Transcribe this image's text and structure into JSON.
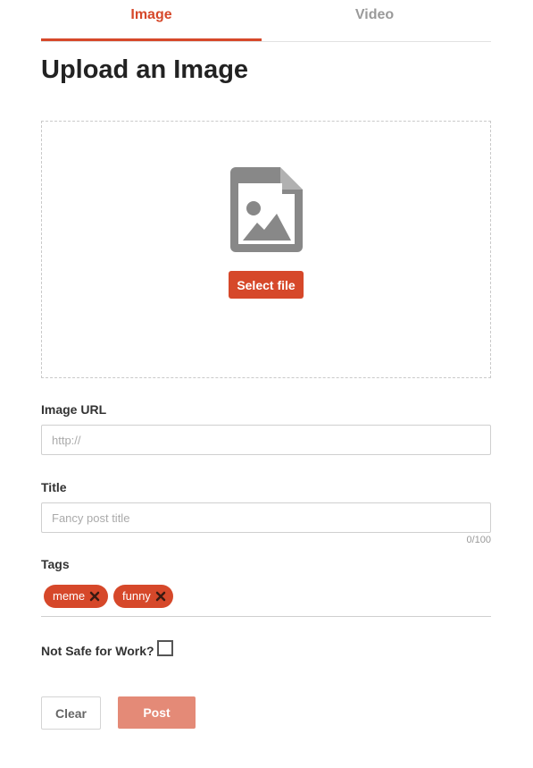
{
  "tabs": [
    {
      "label": "Image",
      "active": true
    },
    {
      "label": "Video",
      "active": false
    }
  ],
  "page_title": "Upload an Image",
  "dropzone": {
    "icon": "image-file-icon",
    "select_label": "Select file"
  },
  "image_url": {
    "label": "Image URL",
    "value": "",
    "placeholder": "http://"
  },
  "title_field": {
    "label": "Title",
    "value": "",
    "placeholder": "Fancy post title",
    "counter": "0/100"
  },
  "tags": {
    "label": "Tags",
    "items": [
      "meme",
      "funny"
    ]
  },
  "nsfw": {
    "label": "Not Safe for Work?",
    "checked": false
  },
  "actions": {
    "clear_label": "Clear",
    "post_label": "Post"
  },
  "colors": {
    "accent": "#d6482a",
    "post_disabled": "#e48a77"
  }
}
